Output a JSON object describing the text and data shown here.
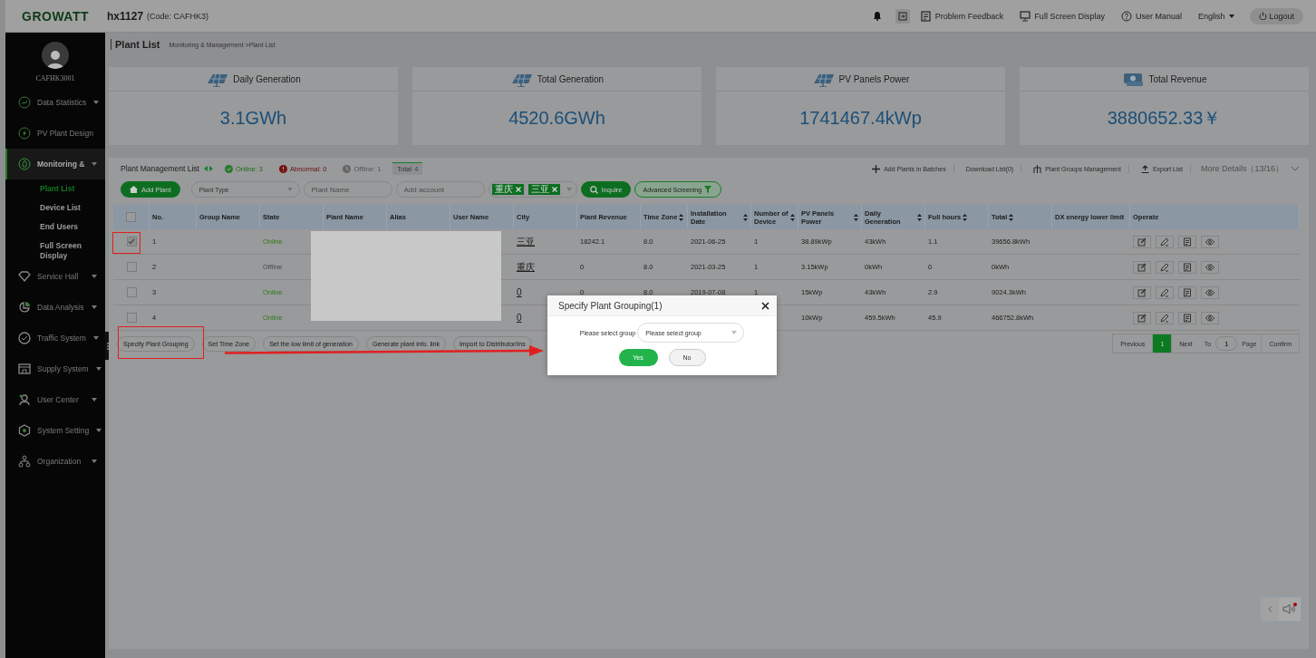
{
  "topbar": {
    "logo": "GROWATT",
    "account": "hx1127",
    "code": "(Code:  CAFHK3)",
    "links": [
      "Problem Feedback",
      "Full Screen Display",
      "User Manual"
    ],
    "language": "English",
    "logout": "Logout"
  },
  "sidebar": {
    "user": "CAFHK3001",
    "items": [
      {
        "label": "Data Statistics",
        "expandable": true,
        "selected": false
      },
      {
        "label": "PV Plant Design",
        "expandable": false,
        "selected": false
      },
      {
        "label": "Monitoring &",
        "expandable": true,
        "selected": true,
        "children": [
          {
            "label": "Plant List",
            "selected": true
          },
          {
            "label": "Device List",
            "selected": false
          },
          {
            "label": "End Users",
            "selected": false
          },
          {
            "label": "Full Screen Display",
            "selected": false
          }
        ]
      },
      {
        "label": "Service Hall",
        "expandable": true,
        "selected": false
      },
      {
        "label": "Data Analysis",
        "expandable": true,
        "selected": false
      },
      {
        "label": "Traffic System",
        "expandable": true,
        "selected": false
      },
      {
        "label": "Supply System",
        "expandable": true,
        "selected": false
      },
      {
        "label": "User Center",
        "expandable": true,
        "selected": false
      },
      {
        "label": "System Setting",
        "expandable": true,
        "selected": false
      },
      {
        "label": "Organization",
        "expandable": true,
        "selected": false
      }
    ]
  },
  "breadcrumb": {
    "title": "Plant List",
    "path": "Monitoring & Management >Plant List"
  },
  "stats": [
    {
      "label": "Daily Generation",
      "value": "3.1GWh"
    },
    {
      "label": "Total Generation",
      "value": "4520.6GWh"
    },
    {
      "label": "PV Panels Power",
      "value": "1741467.4kWp"
    },
    {
      "label": "Total Revenue",
      "value": "3880652.33￥"
    }
  ],
  "list": {
    "title": "Plant Management List",
    "filters": [
      {
        "kind": "online",
        "label": "Online: 3",
        "selected": false
      },
      {
        "kind": "abnormal",
        "label": "Abnormal: 0",
        "selected": false
      },
      {
        "kind": "offline",
        "label": "Offline: 1",
        "selected": false
      },
      {
        "kind": "total",
        "label": "Total",
        "count": "4",
        "selected": true
      }
    ],
    "actions": [
      {
        "kind": "plus",
        "label": "Add Plants in Batches"
      },
      {
        "kind": "plain",
        "label": "Download List(0)"
      },
      {
        "kind": "tree",
        "label": "Plant Groups Management"
      },
      {
        "kind": "upload",
        "label": "Export List"
      }
    ],
    "more": "More Details（13/16）"
  },
  "toolbar": {
    "add_button": "Add Plant",
    "plant_type": {
      "placeholder": "Plant Type"
    },
    "plant_name": {
      "placeholder": "Plant Name"
    },
    "account": {
      "placeholder": "Add account"
    },
    "city_tags": [
      "重庆",
      "三亚"
    ],
    "inquire": "Inquire",
    "advanced": "Advanced Screening"
  },
  "table": {
    "select_all": {
      "checked": false
    },
    "columns": [
      {
        "label": "No.",
        "kind": "text",
        "sortable": false
      },
      {
        "label": "Group Name",
        "kind": "text",
        "sortable": false
      },
      {
        "label": "State",
        "kind": "state",
        "sortable": false
      },
      {
        "label": "Plant Name",
        "kind": "text",
        "sortable": false
      },
      {
        "label": "Alias",
        "kind": "text",
        "sortable": false
      },
      {
        "label": "User Name",
        "kind": "text",
        "sortable": false
      },
      {
        "label": "City",
        "kind": "link",
        "sortable": false
      },
      {
        "label": "Plant Revenue",
        "kind": "text",
        "sortable": false
      },
      {
        "label": "Time Zone",
        "kind": "text",
        "sortable": true
      },
      {
        "label": "Installation Date",
        "kind": "text",
        "sortable": true
      },
      {
        "label": "Number of Device",
        "kind": "text",
        "sortable": true
      },
      {
        "label": "PV Panels Power",
        "kind": "text",
        "sortable": true
      },
      {
        "label": "Daily Generation",
        "kind": "text",
        "sortable": true
      },
      {
        "label": "Full hours",
        "kind": "text",
        "sortable": true
      },
      {
        "label": "Total",
        "kind": "text",
        "sortable": true
      },
      {
        "label": "DX energy lower limit",
        "kind": "text",
        "sortable": false
      },
      {
        "label": "Operate",
        "kind": "operate",
        "sortable": false
      }
    ],
    "rows": [
      {
        "checked": true,
        "online": true,
        "cells": [
          "1",
          null,
          "Online",
          null,
          null,
          null,
          "三亚",
          "18242.1",
          "8.0",
          "2021-06-25",
          "1",
          "38.89kWp",
          "43kWh",
          "1.1",
          "39656.8kWh",
          null,
          null
        ]
      },
      {
        "checked": false,
        "online": false,
        "cells": [
          "2",
          null,
          "Offline",
          null,
          null,
          null,
          "重庆",
          "0",
          "8.0",
          "2021-03-25",
          "1",
          "3.15kWp",
          "0kWh",
          "0",
          "0kWh",
          null,
          null
        ]
      },
      {
        "checked": false,
        "online": true,
        "cells": [
          "3",
          null,
          "Online",
          null,
          null,
          null,
          "0",
          "0",
          "8.0",
          "2019-07-08",
          "1",
          "15kWp",
          "43kWh",
          "2.9",
          "9024.3kWh",
          null,
          null
        ]
      },
      {
        "checked": false,
        "online": true,
        "cells": [
          "4",
          null,
          "Online",
          null,
          null,
          null,
          "0",
          null,
          null,
          null,
          null,
          "10kWp",
          "459.5kWh",
          "45.9",
          "466752.8kWh",
          null,
          null
        ]
      }
    ]
  },
  "bulk_actions": [
    "Specify Plant Grouping",
    "Set Time Zone",
    "Set the low limit of generation",
    "Generate plant info. link",
    "Import to Distributor/Ins"
  ],
  "pagination": {
    "previous": "Previous",
    "pages": [
      {
        "label": "1",
        "selected": true
      }
    ],
    "next": "Next",
    "to": "To",
    "page_input": "1",
    "page": "Page",
    "confirm": "Confirm"
  },
  "dialog": {
    "title": "Specify Plant Grouping(1)",
    "label": "Please select group",
    "placeholder": "Please select group",
    "yes": "Yes",
    "no": "No"
  }
}
